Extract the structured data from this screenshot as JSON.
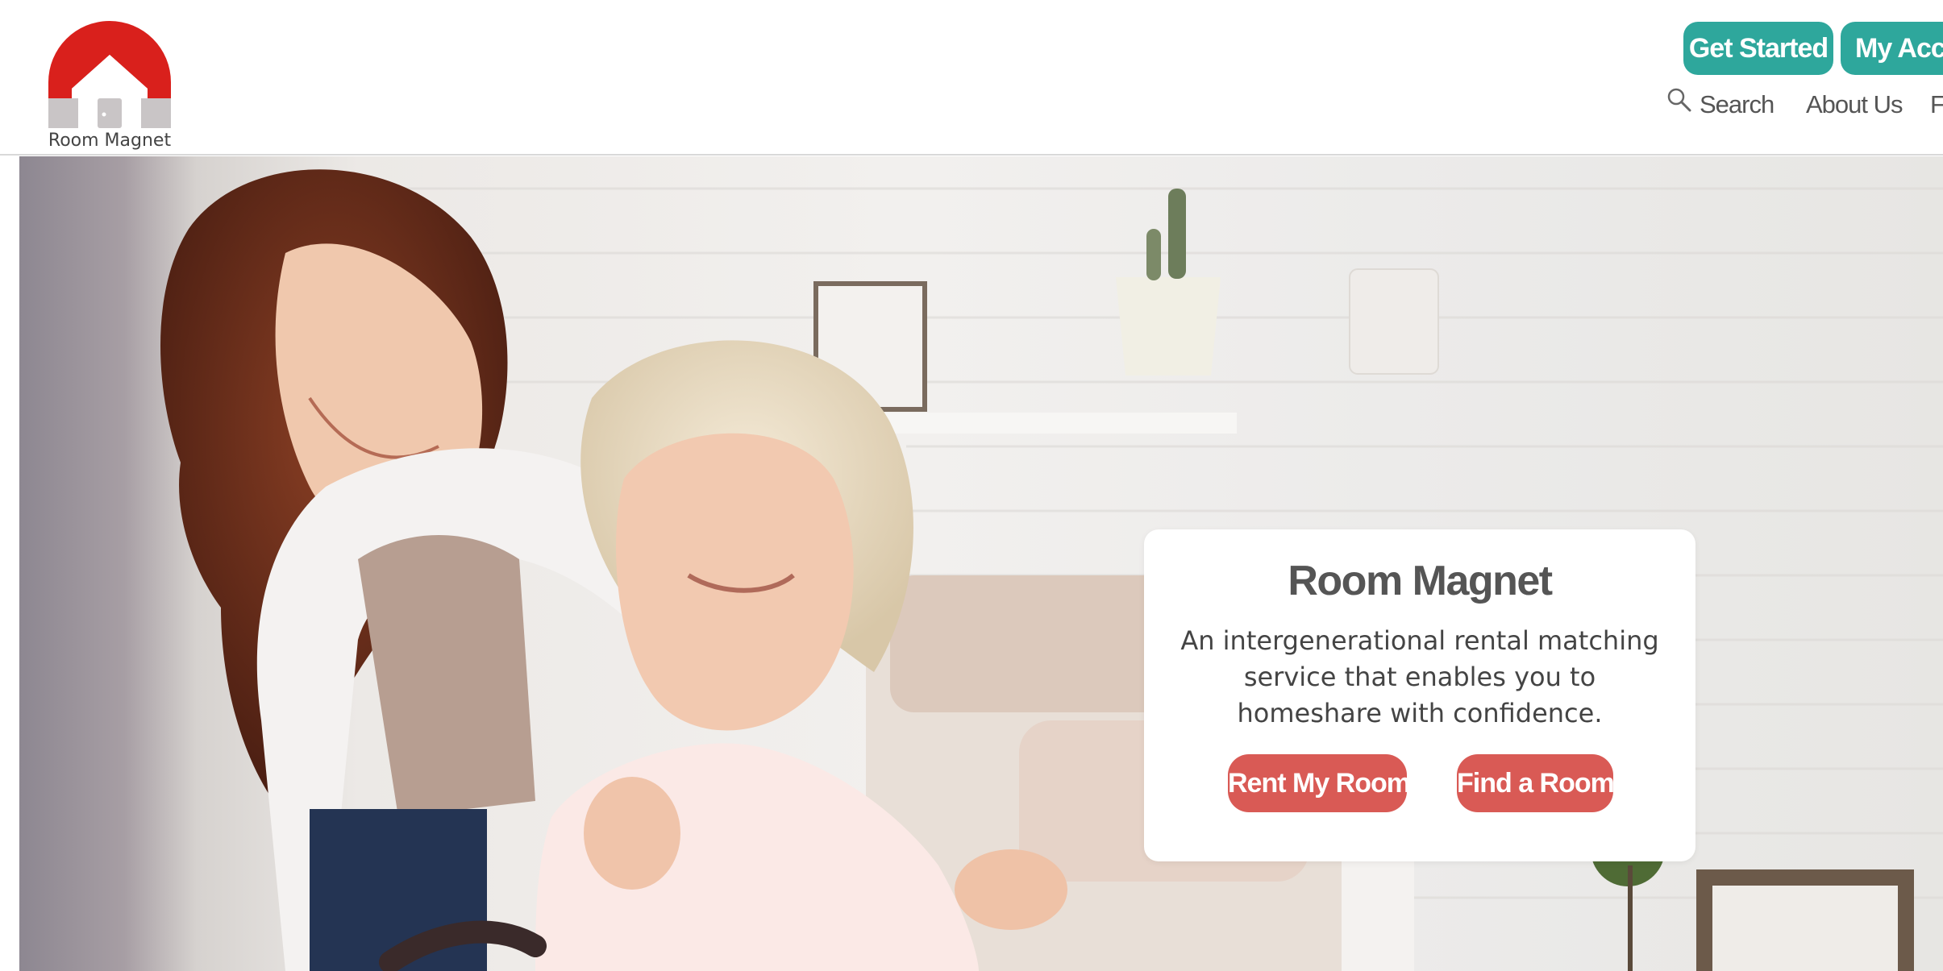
{
  "brand": {
    "logo_text": "Room Magnet",
    "logo_colors": {
      "roof": "#d9201c",
      "house": "#c9c5c6",
      "door": "#ffffff"
    }
  },
  "header": {
    "buttons": {
      "get_started": "Get Started",
      "my_account": "My Account"
    },
    "nav": {
      "search": "Search",
      "about": "About Us",
      "faq": "FAQ"
    }
  },
  "hero": {
    "title": "Room Magnet",
    "description": "An intergenerational rental matching service that enables you to homeshare with confidence.",
    "buttons": {
      "rent": "Rent My Room",
      "find": "Find a Room"
    }
  },
  "colors": {
    "teal": "#2ea79c",
    "coral": "#d95a55",
    "nav_text": "#555555"
  },
  "icons": {
    "search": "search-icon",
    "logo": "house-roof-icon"
  }
}
